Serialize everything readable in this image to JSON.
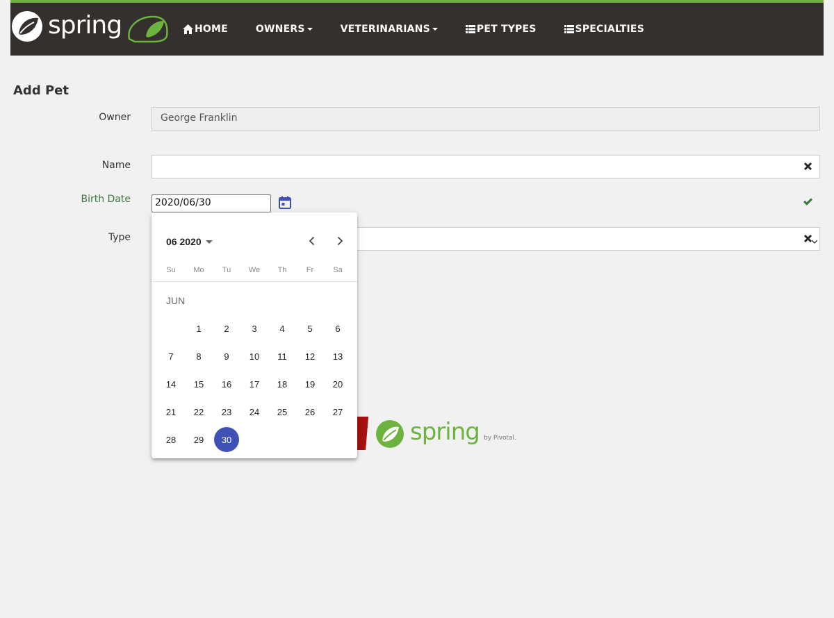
{
  "brand": {
    "name": "spring"
  },
  "nav": {
    "items": [
      {
        "label": "Home",
        "icon": "home-icon",
        "dropdown": false
      },
      {
        "label": "Owners",
        "icon": "",
        "dropdown": true
      },
      {
        "label": "Veterinarians",
        "icon": "",
        "dropdown": true
      },
      {
        "label": "Pet Types",
        "icon": "list-icon",
        "dropdown": false
      },
      {
        "label": "Specialties",
        "icon": "list-icon",
        "dropdown": false
      }
    ]
  },
  "form": {
    "title": "Add Pet",
    "owner_label": "Owner",
    "owner_value": "George Franklin",
    "name_label": "Name",
    "name_value": "",
    "birth_label": "Birth Date",
    "birth_value": "2020/06/30",
    "type_label": "Type",
    "type_value": ""
  },
  "calendar": {
    "period": "06 2020",
    "month_label": "JUN",
    "weekdays": [
      "Su",
      "Mo",
      "Tu",
      "We",
      "Th",
      "Fr",
      "Sa"
    ],
    "weeks": [
      [
        "",
        "1",
        "2",
        "3",
        "4",
        "5",
        "6"
      ],
      [
        "7",
        "8",
        "9",
        "10",
        "11",
        "12",
        "13"
      ],
      [
        "14",
        "15",
        "16",
        "17",
        "18",
        "19",
        "20"
      ],
      [
        "21",
        "22",
        "23",
        "24",
        "25",
        "26",
        "27"
      ],
      [
        "28",
        "29",
        "30",
        "",
        "",
        "",
        ""
      ]
    ],
    "selected_day": "30"
  },
  "footer": {
    "brand": "spring",
    "byline": "by Pivotal."
  },
  "colors": {
    "nav_bg": "#34302d",
    "nav_accent": "#6db33f",
    "selected": "#3f51b5",
    "valid": "#3c763d"
  }
}
